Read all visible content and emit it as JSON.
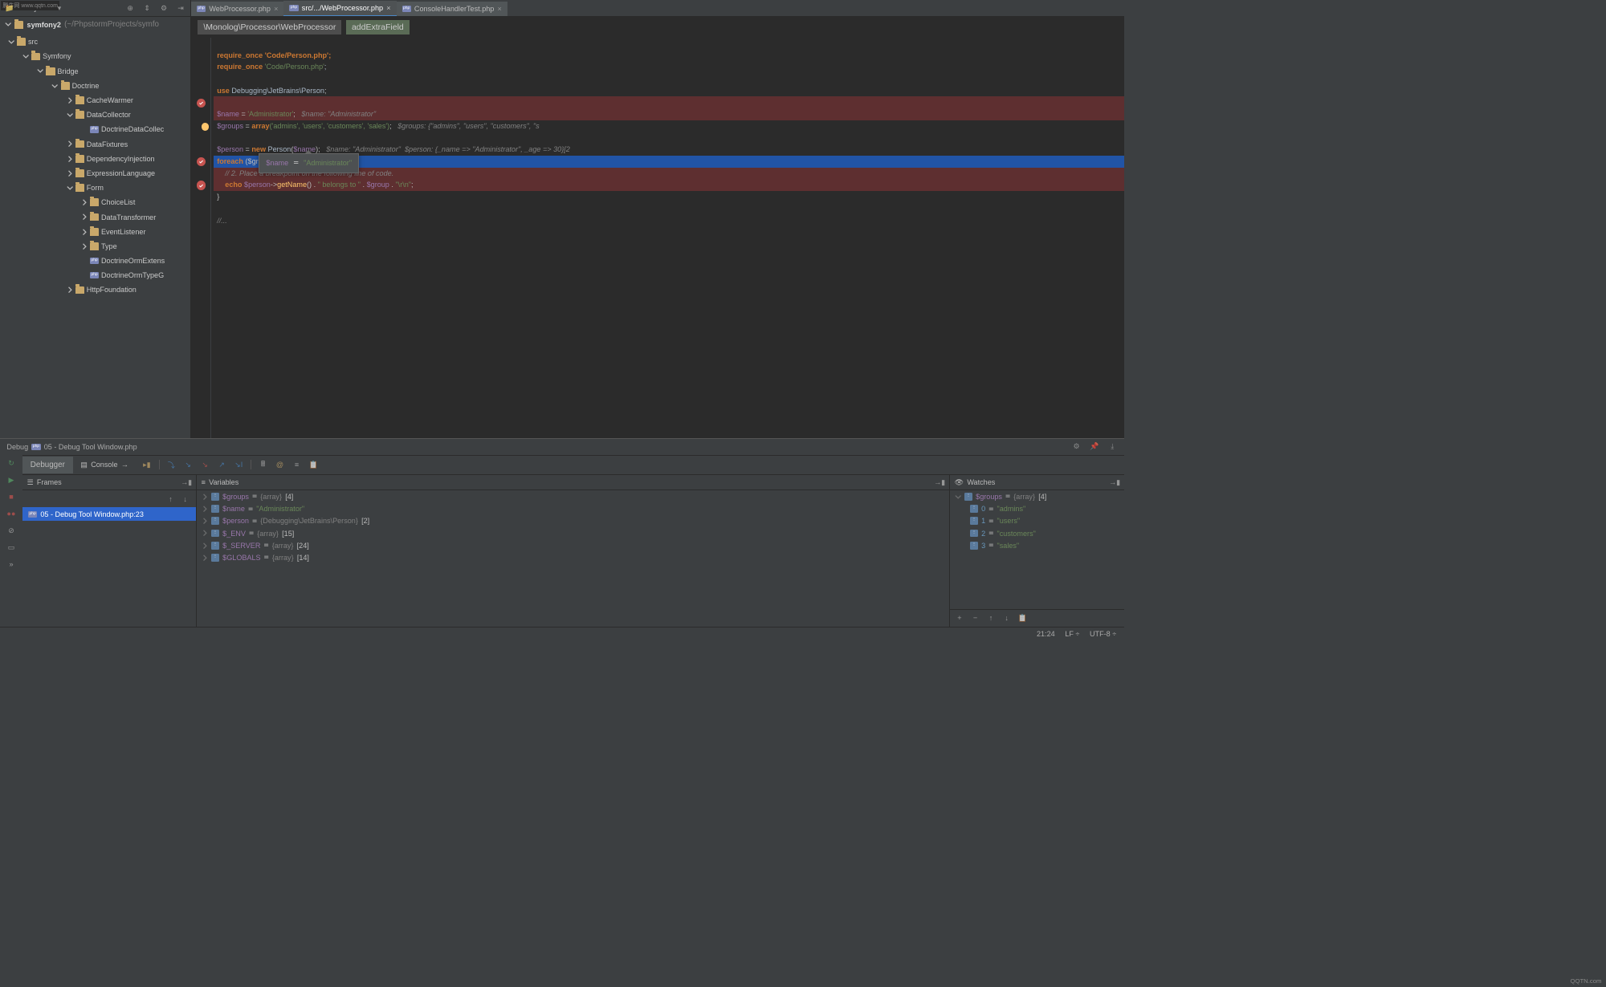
{
  "watermark": "腾牛网 www.qqtn.com",
  "toolbar_label": "Project",
  "project": {
    "name": "symfony2",
    "path": "(~/PhpstormProjects/symfo"
  },
  "tree": [
    {
      "depth": 0,
      "exp": true,
      "icon": "folder",
      "label": "src"
    },
    {
      "depth": 1,
      "exp": true,
      "icon": "folder",
      "label": "Symfony"
    },
    {
      "depth": 2,
      "exp": true,
      "icon": "folder",
      "label": "Bridge"
    },
    {
      "depth": 3,
      "exp": true,
      "icon": "folder",
      "label": "Doctrine"
    },
    {
      "depth": 4,
      "exp": false,
      "chv": true,
      "icon": "folder",
      "label": "CacheWarmer"
    },
    {
      "depth": 4,
      "exp": true,
      "icon": "folder",
      "label": "DataCollector"
    },
    {
      "depth": 5,
      "icon": "php",
      "label": "DoctrineDataCollec"
    },
    {
      "depth": 4,
      "exp": false,
      "chv": true,
      "icon": "folder",
      "label": "DataFixtures"
    },
    {
      "depth": 4,
      "exp": false,
      "chv": true,
      "icon": "folder",
      "label": "DependencyInjection"
    },
    {
      "depth": 4,
      "exp": false,
      "chv": true,
      "icon": "folder",
      "label": "ExpressionLanguage"
    },
    {
      "depth": 4,
      "exp": true,
      "icon": "folder",
      "label": "Form"
    },
    {
      "depth": 5,
      "exp": false,
      "chv": true,
      "icon": "folder",
      "label": "ChoiceList"
    },
    {
      "depth": 5,
      "exp": false,
      "chv": true,
      "icon": "folder",
      "label": "DataTransformer"
    },
    {
      "depth": 5,
      "exp": false,
      "chv": true,
      "icon": "folder",
      "label": "EventListener"
    },
    {
      "depth": 5,
      "exp": false,
      "chv": true,
      "icon": "folder",
      "label": "Type"
    },
    {
      "depth": 5,
      "icon": "php",
      "label": "DoctrineOrmExtens"
    },
    {
      "depth": 5,
      "icon": "php",
      "label": "DoctrineOrmTypeG"
    },
    {
      "depth": 4,
      "exp": false,
      "chv": true,
      "icon": "folder",
      "label": "HttpFoundation"
    }
  ],
  "tabs": [
    {
      "label": "WebProcessor.php",
      "active": false
    },
    {
      "label": "src/.../WebProcessor.php",
      "active": true
    },
    {
      "label": "ConsoleHandlerTest.php",
      "active": false
    }
  ],
  "breadcrumb": {
    "path": "\\Monolog\\Processor\\WebProcessor",
    "method": "addExtraField"
  },
  "code": {
    "l1": "require_once 'Code/Person.php';",
    "l2": "use Debugging\\JetBrains\\Person;",
    "l3_var": "$name",
    "l3_val": "'Administrator'",
    "l3_hint": "$name: \"Administrator\"",
    "l4_var": "$groups",
    "l4_kw": "array",
    "l4_args": "('admins', 'users', 'customers', 'sales')",
    "l4_hint": "$groups: {\"admins\", \"users\", \"customers\", \"s",
    "l5_var": "$person",
    "l5_kw": "new",
    "l5_cls": "Person",
    "l5_arg": "$name",
    "l5_hint": "$name: \"Administrator\"  $person: {_name => \"Administrator\", _age => 30}[2",
    "l6_kw": "foreach",
    "l6_arg": "($gr",
    "l7_cmt": "// 2. Place a breakpoint on the following line of code.",
    "l8_kw": "echo",
    "l8_var": "$person",
    "l8_fn": "getName",
    "l8_s1": "\" belongs to \"",
    "l8_v2": "$group",
    "l8_s2": "\"\\r\\n\"",
    "l9": "}",
    "l10": "//...",
    "tooltip_var": "$name",
    "tooltip_val": "\"Administrator\""
  },
  "debug": {
    "title": "Debug",
    "config": "05 - Debug Tool Window.php",
    "tab1": "Debugger",
    "tab2": "Console",
    "frames_title": "Frames",
    "frame0": "05 - Debug Tool Window.php:23",
    "vars_title": "Variables",
    "vars": [
      {
        "name": "$groups",
        "type": "{array}",
        "count": "[4]"
      },
      {
        "name": "$name",
        "val": "\"Administrator\""
      },
      {
        "name": "$person",
        "type": "{Debugging\\JetBrains\\Person}",
        "count": "[2]"
      },
      {
        "name": "$_ENV",
        "type": "{array}",
        "count": "[15]"
      },
      {
        "name": "$_SERVER",
        "type": "{array}",
        "count": "[24]"
      },
      {
        "name": "$GLOBALS",
        "type": "{array}",
        "count": "[14]"
      }
    ],
    "watches_title": "Watches",
    "watches": {
      "root": {
        "name": "$groups",
        "type": "{array}",
        "count": "[4]"
      },
      "items": [
        {
          "key": "0",
          "val": "\"admins\""
        },
        {
          "key": "1",
          "val": "\"users\""
        },
        {
          "key": "2",
          "val": "\"customers\""
        },
        {
          "key": "3",
          "val": "\"sales\""
        }
      ]
    }
  },
  "status": {
    "pos": "21:24",
    "le": "LF ÷",
    "enc": "UTF-8 ÷"
  },
  "logo": "QQTN.com"
}
